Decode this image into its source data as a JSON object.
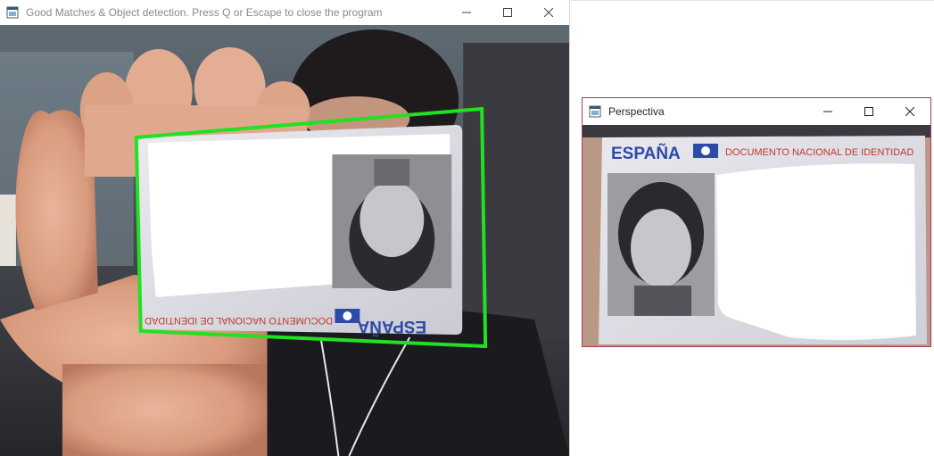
{
  "main_window": {
    "title": "Good Matches & Object detection. Press Q or Escape to close the program",
    "controls": {
      "minimize": "minimize-icon",
      "maximize": "maximize-icon",
      "close": "close-icon"
    },
    "card_text_mirrored": {
      "country": "ESPAÑA",
      "document": "DOCUMENTO NACIONAL DE IDENTIDAD"
    },
    "detection_box_color": "#22e022"
  },
  "perspective_window": {
    "title": "Perspectiva",
    "controls": {
      "minimize": "minimize-icon",
      "maximize": "maximize-icon",
      "close": "close-icon"
    },
    "card_text": {
      "country": "ESPAÑA",
      "document": "DOCUMENTO NACIONAL DE IDENTIDAD"
    }
  },
  "colors": {
    "card_blue": "#2e4aa8",
    "card_red": "#c0392b",
    "perspective_border": "#b0365a"
  }
}
